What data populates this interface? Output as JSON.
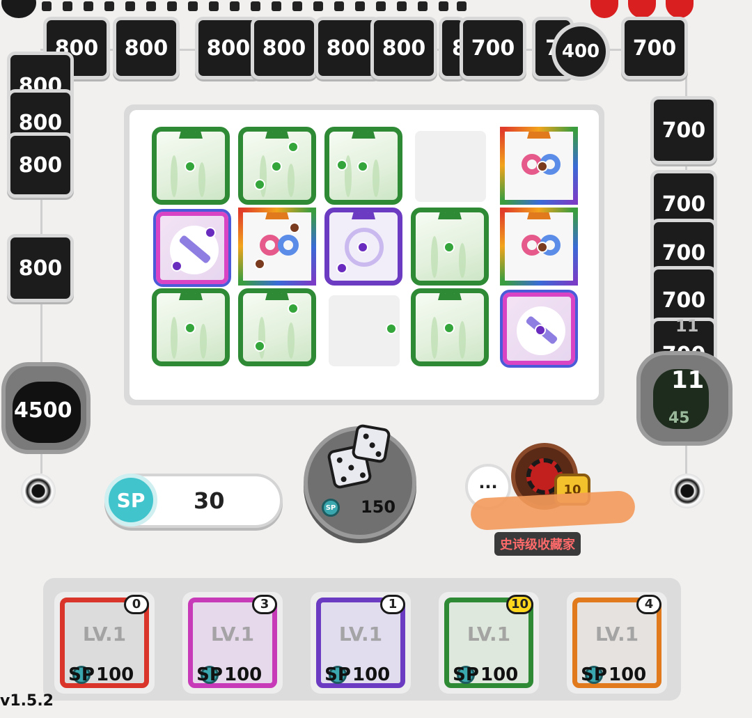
{
  "top_enemies": [
    "800",
    "800",
    "800",
    "800",
    "800",
    "800",
    "8",
    "700",
    "7",
    "700"
  ],
  "top_round_enemy": "400",
  "left_enemies": [
    "800",
    "800",
    "800",
    "800"
  ],
  "right_enemies": [
    "700",
    "700",
    "700",
    "700",
    "700"
  ],
  "left_boss": "4500",
  "right_counter_top": "11",
  "right_counter_main": "11",
  "right_counter_bottom": "45",
  "sp": {
    "label": "SP",
    "value": "30"
  },
  "roll": {
    "cost_label": "SP",
    "cost": "150"
  },
  "opponent": {
    "chat_icon": "···",
    "rank_badge": "10",
    "title": "史诗级收藏家"
  },
  "deck": [
    {
      "level": "LV.1",
      "upgrades": "0",
      "cost_label": "SP",
      "cost": "100",
      "color": "#d9352a"
    },
    {
      "level": "LV.1",
      "upgrades": "3",
      "cost_label": "SP",
      "cost": "100",
      "color": "#c83bb8"
    },
    {
      "level": "LV.1",
      "upgrades": "1",
      "cost_label": "SP",
      "cost": "100",
      "color": "#6b3cc1"
    },
    {
      "level": "LV.1",
      "upgrades": "10",
      "cost_label": "SP",
      "cost": "100",
      "color": "#2f8a35"
    },
    {
      "level": "LV.1",
      "upgrades": "4",
      "cost_label": "SP",
      "cost": "100",
      "color": "#e07a1d"
    }
  ],
  "version": "v1.5.2"
}
